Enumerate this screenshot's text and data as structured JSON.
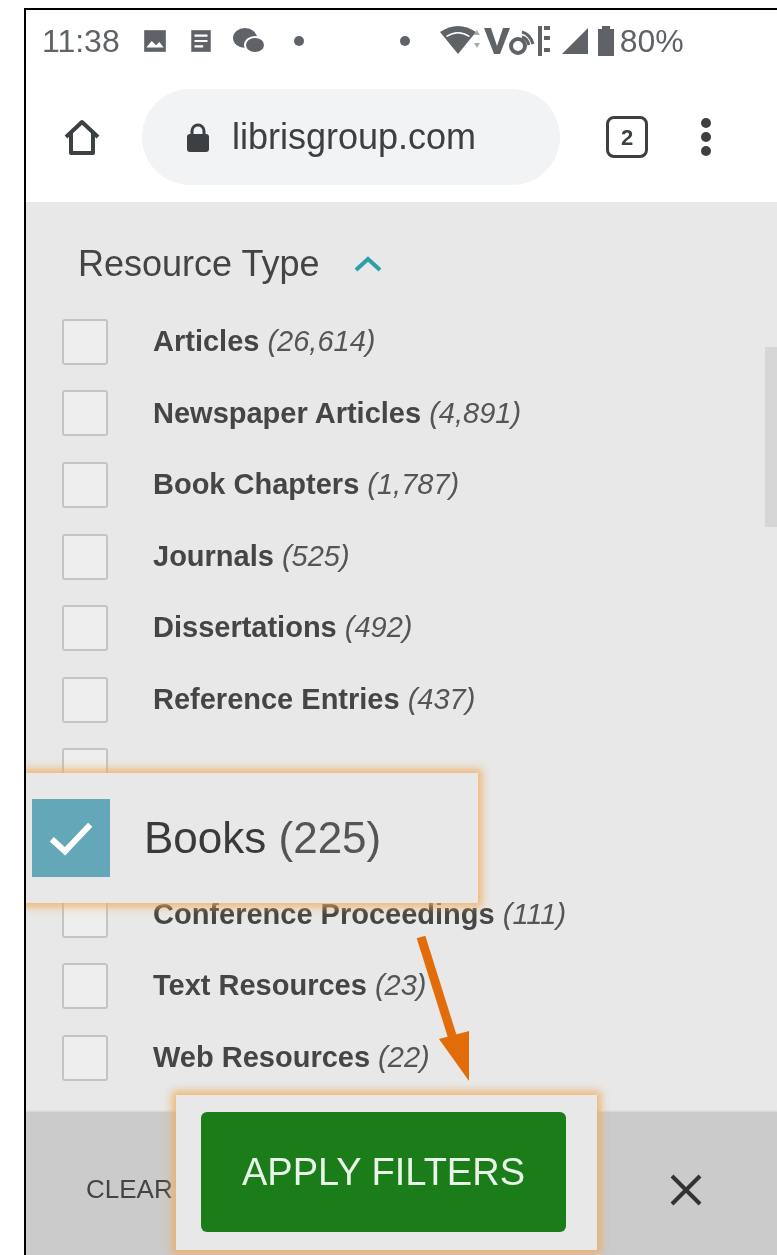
{
  "status_bar": {
    "time": "11:38",
    "battery": "80%"
  },
  "toolbar": {
    "url": "librisgroup.com",
    "tab_count": "2"
  },
  "filter": {
    "heading": "Resource Type",
    "expanded": true,
    "items": [
      {
        "kind": "row",
        "label": "Articles",
        "count": "(26,614)",
        "checked": false
      },
      {
        "kind": "row",
        "label": "Newspaper Articles",
        "count": "(4,891)",
        "checked": false
      },
      {
        "kind": "row",
        "label": "Book Chapters",
        "count": "(1,787)",
        "checked": false
      },
      {
        "kind": "row",
        "label": "Journals",
        "count": "(525)",
        "checked": false
      },
      {
        "kind": "row",
        "label": "Dissertations",
        "count": "(492)",
        "checked": false
      },
      {
        "kind": "row",
        "label": "Reference Entries",
        "count": "(437)",
        "checked": false
      },
      {
        "kind": "row",
        "checked": false
      },
      {
        "kind": "callout",
        "label": "Books",
        "count": "(225)",
        "checked": true
      },
      {
        "kind": "row",
        "label": "Conference Proceedings",
        "count": "(111)",
        "checked": false
      },
      {
        "kind": "row",
        "label": "Text Resources",
        "count": "(23)",
        "checked": false
      },
      {
        "kind": "row",
        "label": "Web Resources",
        "count": "(22)",
        "checked": false
      }
    ]
  },
  "bottom_bar": {
    "clear": "CLEAR",
    "apply": "APPLY FILTERS"
  }
}
